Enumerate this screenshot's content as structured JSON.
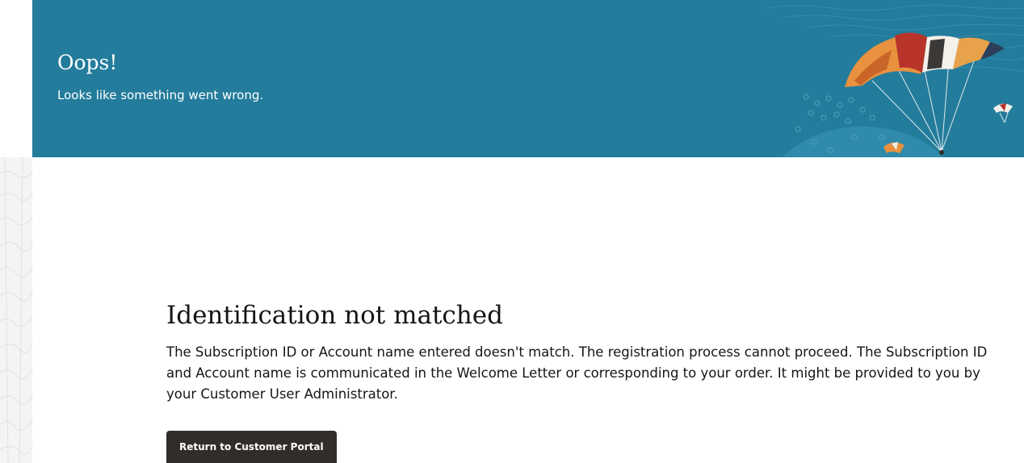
{
  "banner": {
    "title": "Oops!",
    "subtitle": "Looks like something went wrong.",
    "background_color": "#237c9c"
  },
  "main": {
    "heading": "Identification not matched",
    "message": "The Subscription ID or Account name entered doesn't match. The registration process cannot proceed. The Subscription ID and Account name is communicated in the Welcome Letter or corresponding to your order. It might be provided to you by your Customer User Administrator.",
    "button_label": "Return to Customer Portal",
    "button_color": "#312d2a"
  },
  "decorations": {
    "banner_art": "parachute-illustration",
    "left_strip": "topographic-pattern"
  }
}
